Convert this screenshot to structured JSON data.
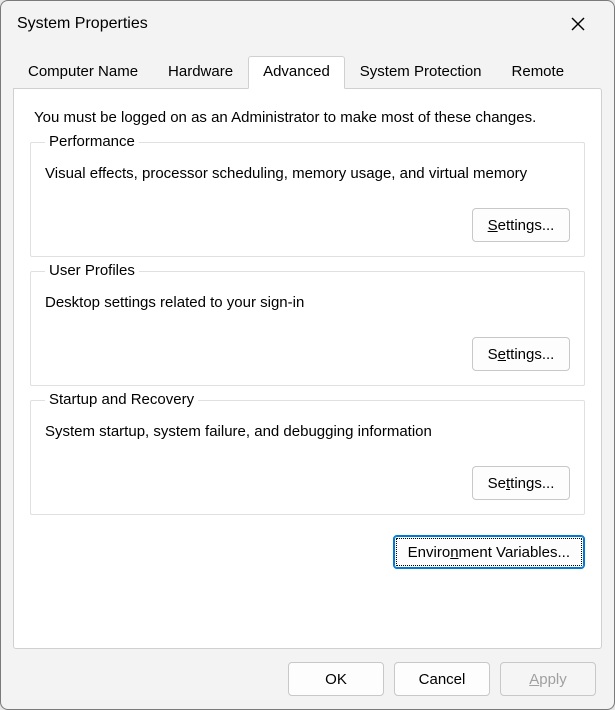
{
  "window": {
    "title": "System Properties"
  },
  "tabs": {
    "computer_name": "Computer Name",
    "hardware": "Hardware",
    "advanced": "Advanced",
    "system_protection": "System Protection",
    "remote": "Remote",
    "active": "advanced"
  },
  "admin_note": "You must be logged on as an Administrator to make most of these changes.",
  "performance": {
    "title": "Performance",
    "desc": "Visual effects, processor scheduling, memory usage, and virtual memory",
    "button_pre": "",
    "button_access": "S",
    "button_post": "ettings..."
  },
  "user_profiles": {
    "title": "User Profiles",
    "desc": "Desktop settings related to your sign-in",
    "button_pre": "S",
    "button_access": "e",
    "button_post": "ttings..."
  },
  "startup": {
    "title": "Startup and Recovery",
    "desc": "System startup, system failure, and debugging information",
    "button_pre": "Se",
    "button_access": "t",
    "button_post": "tings..."
  },
  "envvars": {
    "button_pre": "Enviro",
    "button_access": "n",
    "button_post": "ment Variables..."
  },
  "footer": {
    "ok": "OK",
    "cancel": "Cancel",
    "apply_access": "A",
    "apply_post": "pply"
  }
}
